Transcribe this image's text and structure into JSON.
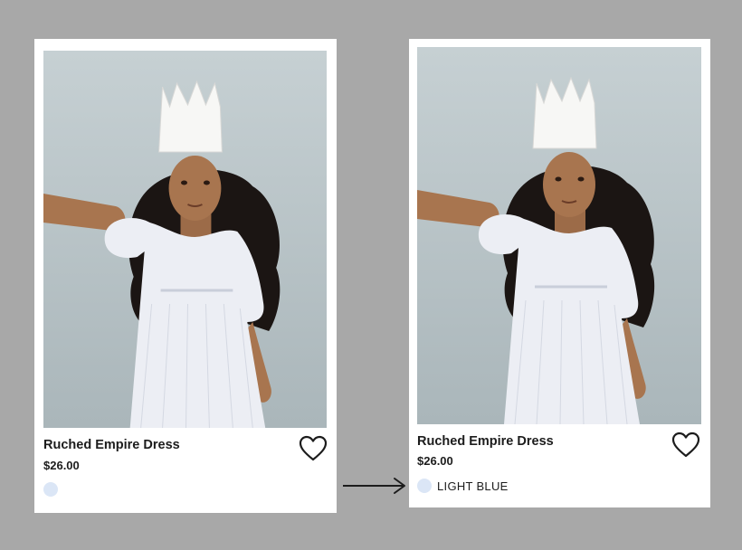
{
  "cards": [
    {
      "name": "Ruched Empire Dress",
      "price": "$26.00",
      "swatch_color": "#dbe6f6",
      "favorite_icon": "heart-outline-icon"
    },
    {
      "name": "Ruched Empire Dress",
      "price": "$26.00",
      "swatch_color": "#dbe6f6",
      "swatch_label": "LIGHT BLUE",
      "favorite_icon": "heart-outline-icon"
    }
  ],
  "transition_icon": "arrow-right-icon",
  "colors": {
    "background": "#a8a8a8",
    "card": "#ffffff",
    "text": "#1c1c1c",
    "swatch": "#dbe6f6"
  }
}
